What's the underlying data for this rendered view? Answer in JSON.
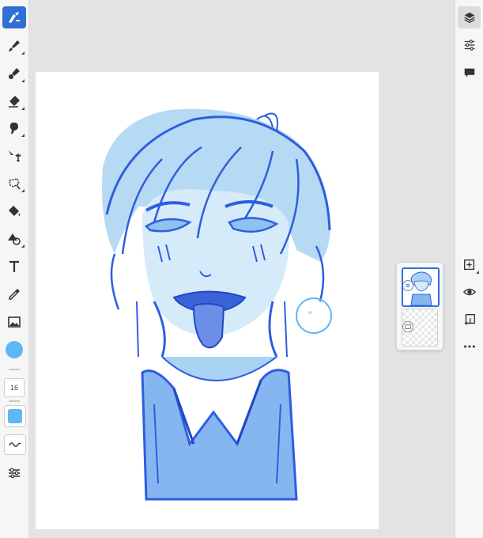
{
  "app": {
    "accent_color": "#2f6fd6",
    "stroke_color": "#2f5de0",
    "current_color": "#5bb8f5"
  },
  "left_toolbar": {
    "tools": [
      {
        "name": "paint-brush-tool",
        "icon": "paint-brush-icon",
        "active": true
      },
      {
        "name": "brush-tool",
        "icon": "brush-icon",
        "active": false
      },
      {
        "name": "pixel-brush-tool",
        "icon": "pixel-brush-icon",
        "active": false
      },
      {
        "name": "eraser-tool",
        "icon": "eraser-icon",
        "active": false
      },
      {
        "name": "smudge-tool",
        "icon": "smudge-icon",
        "active": false
      },
      {
        "name": "transform-tool",
        "icon": "move-arrows-icon",
        "active": false
      },
      {
        "name": "lasso-tool",
        "icon": "lasso-icon",
        "active": false
      },
      {
        "name": "fill-tool",
        "icon": "paint-bucket-icon",
        "active": false
      },
      {
        "name": "shapes-tool",
        "icon": "shapes-icon",
        "active": false
      },
      {
        "name": "text-tool",
        "icon": "text-icon",
        "active": false
      },
      {
        "name": "eyedropper-tool",
        "icon": "eyedropper-icon",
        "active": false
      },
      {
        "name": "image-tool",
        "icon": "image-icon",
        "active": false
      }
    ],
    "brush_size": "16",
    "smoothing_icon": "wave-icon",
    "settings_icon": "sliders-icon"
  },
  "right_toolbar": {
    "top_icons": [
      "layers-icon",
      "adjustments-icon",
      "comment-icon"
    ],
    "bottom_icons": [
      "add-layer-icon",
      "visibility-eye-icon",
      "merge-down-icon",
      "more-icon"
    ]
  },
  "layers": {
    "items": [
      {
        "name": "drawing-layer",
        "selected": true,
        "badge_icon": "blend-mode-icon"
      },
      {
        "name": "background-layer",
        "selected": false,
        "badge_icon": "image-layer-icon"
      }
    ]
  },
  "artwork": {
    "text_marks": "\""
  }
}
